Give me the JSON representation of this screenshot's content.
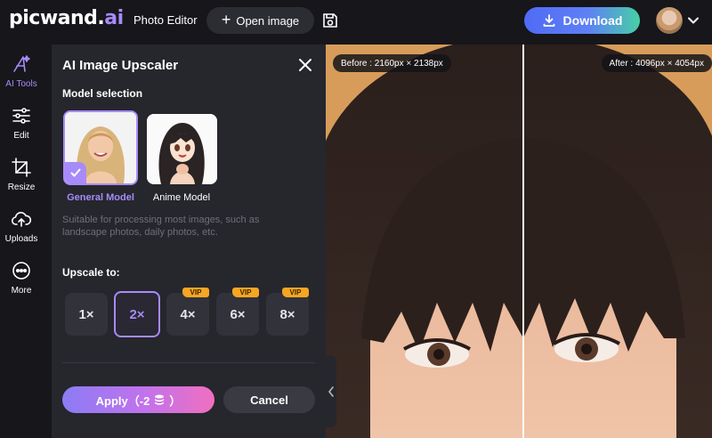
{
  "header": {
    "logo_main": "picwand.",
    "logo_ai": "ai",
    "app_title": "Photo Editor",
    "open_image_label": "Open image",
    "download_label": "Download"
  },
  "rail": {
    "items": [
      {
        "label": "AI Tools",
        "icon": "ai-tools-icon",
        "active": true
      },
      {
        "label": "Edit",
        "icon": "sliders-icon"
      },
      {
        "label": "Resize",
        "icon": "crop-icon"
      },
      {
        "label": "Uploads",
        "icon": "cloud-upload-icon"
      },
      {
        "label": "More",
        "icon": "more-icon"
      }
    ]
  },
  "panel": {
    "title": "AI Image Upscaler",
    "model_section_label": "Model selection",
    "models": [
      {
        "label": "General Model",
        "selected": true
      },
      {
        "label": "Anime Model",
        "selected": false
      }
    ],
    "description": "Suitable for processing most images, such as landscape photos, daily photos, etc.",
    "upscale_label": "Upscale to:",
    "scales": [
      {
        "label": "1×",
        "vip": false
      },
      {
        "label": "2×",
        "vip": false,
        "selected": true
      },
      {
        "label": "4×",
        "vip": true
      },
      {
        "label": "6×",
        "vip": true
      },
      {
        "label": "8×",
        "vip": true
      }
    ],
    "vip_text": "VIP",
    "apply_label": "Apply（-2",
    "apply_suffix": "）",
    "cancel_label": "Cancel"
  },
  "canvas": {
    "before_label": "Before : 2160px × 2138px",
    "after_label": "After : 4096px × 4054px"
  },
  "colors": {
    "accent": "#a78bfa",
    "vip": "#f5a623",
    "background": "#16161b",
    "panel": "#26262d"
  }
}
